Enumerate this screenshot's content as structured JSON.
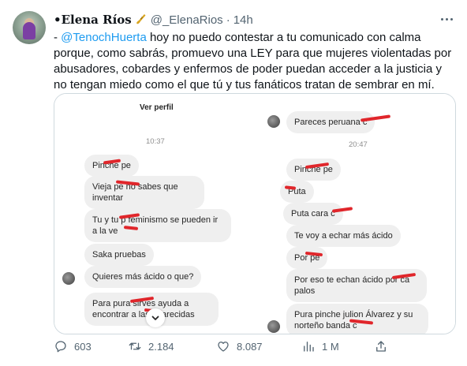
{
  "tweet": {
    "author_name": "•Elena Ríos",
    "badge_icon": "saxophone-emoji",
    "handle": "@_ElenaRios",
    "separator": "·",
    "time": "14h",
    "text_prefix": "- ",
    "mention": "@TenochHuerta",
    "text_body": " hoy no puedo contestar a tu comunicado con calma porque, como sabrás, promuevo una LEY para que mujeres violentadas por abusadores, cobardes y enfermos de poder puedan acceder a la justicia y no tengan miedo como el que tú y tus fanáticos tratan de sembrar en mí."
  },
  "media": {
    "left": {
      "ver_perfil": "Ver perfil",
      "time": "10:37",
      "messages": [
        "Pinche pe",
        "Vieja pe        no sabes que inventar",
        "Tu y tu p        feminismo se pueden ir a la ve",
        "Saka pruebas",
        "Quieres más ácido o que?",
        "Para pura       sirves ayuda a encontrar a las    aparecidas"
      ]
    },
    "right": {
      "top_message": "Pareces peruana c",
      "time": "20:47",
      "messages": [
        "Pinche pe",
        "Puta",
        "Puta cara c",
        "Te voy a echar más ácido",
        "Por pe",
        "Por eso te echan ácido por ca       palos",
        "Pura pinche julion Álvarez y su norteño banda c"
      ]
    }
  },
  "actions": {
    "reply_count": "603",
    "retweet_count": "2.184",
    "like_count": "8.087",
    "views_count": "1 M"
  },
  "colors": {
    "mention": "#1d9bf0",
    "secondary_text": "#536471",
    "redaction": "#e0262b",
    "bubble": "#efefef"
  }
}
